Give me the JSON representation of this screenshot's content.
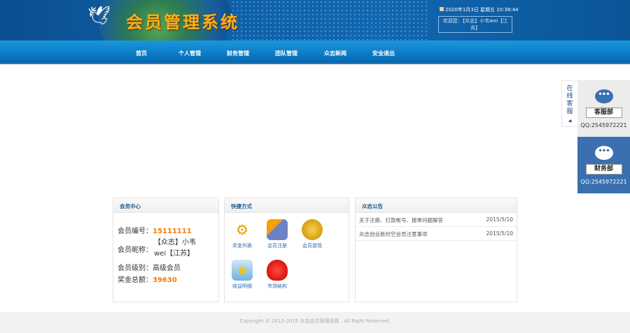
{
  "header": {
    "title": "会员管理系统",
    "date": "2020年1月3日 星期五 10:38:44",
    "welcome": "欢迎您：【众志】小韦wei【江苏】"
  },
  "nav": [
    "首页",
    "个人管理",
    "财务管理",
    "团队管理",
    "众志新闻",
    "安全退出"
  ],
  "member": {
    "title": "会员中心",
    "id_label": "会员编号：",
    "id": "15111111",
    "nick_label": "会员昵称：",
    "nick": "【众志】小韦wei【江苏】",
    "level_label": "会员级别：",
    "level": "高级会员",
    "bonus_label": "奖金总额：",
    "bonus": "39630"
  },
  "shortcuts": {
    "title": "快捷方式",
    "items": [
      {
        "label": "奖金列表",
        "icon": "gear-coins-icon"
      },
      {
        "label": "会员注册",
        "icon": "user-book-icon"
      },
      {
        "label": "会员提现",
        "icon": "gold-coins-icon"
      },
      {
        "label": "收益明细",
        "icon": "star-box-icon"
      },
      {
        "label": "市场结构",
        "icon": "money-bag-icon"
      }
    ]
  },
  "notices": {
    "title": "众志公告",
    "items": [
      {
        "text": "关于注册、打款帐号、报单问题解答",
        "date": "2015/5/10"
      },
      {
        "text": "众志创业新时空会员注意事项",
        "date": "2015/5/10"
      }
    ]
  },
  "service": {
    "tab": "在线客服",
    "depts": [
      {
        "label": "客服部",
        "qq": "QQ:2545972221"
      },
      {
        "label": "财务部",
        "qq": "QQ:2545972221"
      }
    ]
  },
  "footer": "Copyright © 2013-2015 众志会员管理系统 . All Right Reserved."
}
